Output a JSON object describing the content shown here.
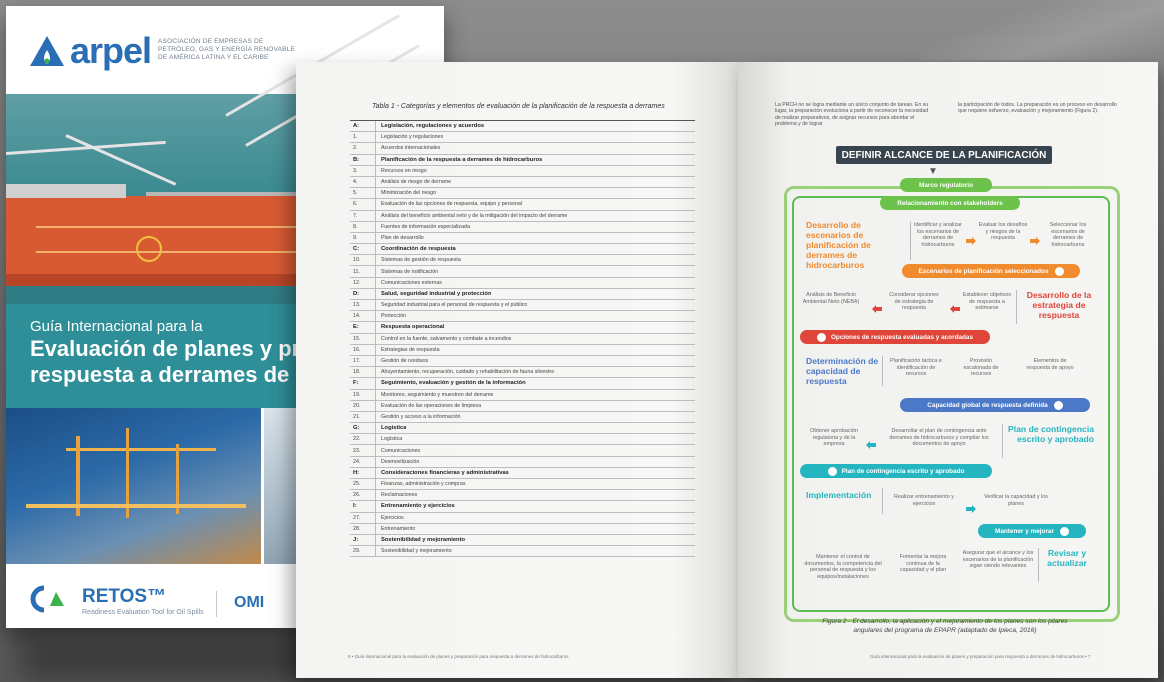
{
  "cover": {
    "logo_word": "arpel",
    "logo_desc": "ASOCIACIÓN DE EMPRESAS DE PETRÓLEO, GAS Y ENERGÍA RENOVABLE DE AMÉRICA LATINA Y EL CARIBE",
    "subtitle": "Guía Internacional para la",
    "title_line1": "Evaluación de planes y prep",
    "title_line2": "respuesta a derrames de hi",
    "retos_label": "RETOS™",
    "retos_sub": "Readiness Evaluation Tool for Oil Spills",
    "omi_label": "OMI"
  },
  "left_page": {
    "table_title": "Tabla 1 - Categorías y elementos de evaluación de la planificación de la respuesta a derrames",
    "rows": [
      {
        "id": "A:",
        "text": "Legislación, regulaciones y acuerdos",
        "section": true
      },
      {
        "id": "1.",
        "text": "Legislación y regulaciones",
        "section": false
      },
      {
        "id": "2.",
        "text": "Acuerdos internacionales",
        "section": false
      },
      {
        "id": "B:",
        "text": "Planificación de la respuesta a derrames de hidrocarburos",
        "section": true
      },
      {
        "id": "3.",
        "text": "Recursos en riesgo",
        "section": false
      },
      {
        "id": "4.",
        "text": "Análisis de riesgo de derrame",
        "section": false
      },
      {
        "id": "5.",
        "text": "Minimización del riesgo",
        "section": false
      },
      {
        "id": "6.",
        "text": "Evaluación de las opciones de respuesta, equipo y personal",
        "section": false
      },
      {
        "id": "7.",
        "text": "Análisis del beneficio ambiental neto y de la mitigación del impacto del derrame",
        "section": false
      },
      {
        "id": "8.",
        "text": "Fuentes de información especializada",
        "section": false
      },
      {
        "id": "9.",
        "text": "Plan de desarrollo",
        "section": false
      },
      {
        "id": "C:",
        "text": "Coordinación de respuesta",
        "section": true
      },
      {
        "id": "10.",
        "text": "Sistemas de gestión de respuesta",
        "section": false
      },
      {
        "id": "11.",
        "text": "Sistemas de notificación",
        "section": false
      },
      {
        "id": "12.",
        "text": "Comunicaciones externas",
        "section": false
      },
      {
        "id": "D:",
        "text": "Salud, seguridad industrial y protección",
        "section": true
      },
      {
        "id": "13.",
        "text": "Seguridad industrial para el personal de respuesta y el público",
        "section": false
      },
      {
        "id": "14.",
        "text": "Protección",
        "section": false
      },
      {
        "id": "E:",
        "text": "Respuesta operacional",
        "section": true
      },
      {
        "id": "15.",
        "text": "Control en la fuente, salvamento y combate a incendios",
        "section": false
      },
      {
        "id": "16.",
        "text": "Estrategias de respuesta",
        "section": false
      },
      {
        "id": "17.",
        "text": "Gestión de residuos",
        "section": false
      },
      {
        "id": "18.",
        "text": "Ahuyentamiento, recuperación, cuidado y rehabilitación de fauna silvestre",
        "section": false
      },
      {
        "id": "F:",
        "text": "Seguimiento, evaluación y gestión de la información",
        "section": true
      },
      {
        "id": "19.",
        "text": "Monitoreo, seguimiento y muestreo del derrame",
        "section": false
      },
      {
        "id": "20.",
        "text": "Evaluación de las operaciones de limpieza",
        "section": false
      },
      {
        "id": "21.",
        "text": "Gestión y acceso a la información",
        "section": false
      },
      {
        "id": "G:",
        "text": "Logística",
        "section": true
      },
      {
        "id": "22.",
        "text": "Logística",
        "section": false
      },
      {
        "id": "23.",
        "text": "Comunicaciones",
        "section": false
      },
      {
        "id": "24.",
        "text": "Desmovilización",
        "section": false
      },
      {
        "id": "H:",
        "text": "Consideraciones financieras y administrativas",
        "section": true
      },
      {
        "id": "25.",
        "text": "Finanzas, administración y compras",
        "section": false
      },
      {
        "id": "26.",
        "text": "Reclamaciones",
        "section": false
      },
      {
        "id": "I:",
        "text": "Entrenamiento y ejercicios",
        "section": true
      },
      {
        "id": "27.",
        "text": "Ejercicios",
        "section": false
      },
      {
        "id": "28.",
        "text": "Entrenamiento",
        "section": false
      },
      {
        "id": "J:",
        "text": "Sostenibilidad y mejoramiento",
        "section": true
      },
      {
        "id": "29.",
        "text": "Sostenibilidad y mejoramiento",
        "section": false
      }
    ],
    "footer": "8 • Guía internacional para la evaluación de planes y preparación para respuesta a derrames de hidrocarburos"
  },
  "right_page": {
    "para_left": "La PRCH no se logra mediante un único conjunto de tareas. En su lugar, la preparación evoluciona a partir de reconocer la necesidad de realizar preparativos, de asignar recursos para abordar el problema y de lograr",
    "para_right": "la participación de todos. La preparación es un proceso en desarrollo que requiere esfuerzo, evaluación y mejoramiento (Figura 2).",
    "diagram_title": "DEFINIR ALCANCE DE LA PLANIFICACIÓN",
    "pill_marco": "Marco regulatorio",
    "pill_relacion": "Relacionamiento con stakeholders",
    "big_escenarios": "Desarrollo de escenarios de planificación de derrames de hidrocarburos",
    "s_identificar": "Identificar y analizar los escenarios de derrames de hidrocarburos",
    "s_evaluar": "Evaluar los desafíos y riesgos de la respuesta",
    "s_seleccionar": "Seleccionar los escenarios de derrames de hidrocarburos",
    "pill_escenarios_sel": "Escenarios de planificación seleccionados",
    "s_analisis": "Análisis de Beneficio Ambiental Neto (NEBA)",
    "s_considerar": "Considerar opciones de estrategia de respuesta",
    "s_establecer": "Establecer objetivos de respuesta a estimarse",
    "big_estrategia": "Desarrollo de la estrategia de respuesta",
    "pill_opciones": "Opciones de respuesta evaluadas y acordadas",
    "big_capacidad": "Determinación de capacidad de respuesta",
    "s_planificacion": "Planificación táctica e identificación de recursos",
    "s_provision": "Provisión escalonada de recursos",
    "s_elementos": "Elementos de respuesta de apoyo",
    "pill_capacidad": "Capacidad global de respuesta definida",
    "s_obtener": "Obtener aprobación regulatoria y de la empresa",
    "s_desarrollar": "Desarrollar el plan de contingencia ante derrames de hidrocarburos y compilar los documentos de apoyo",
    "big_plan": "Plan de contingencia escrito y aprobado",
    "pill_plan": "Plan de contingencia escrito y aprobado",
    "big_implementacion": "Implementación",
    "s_realizar": "Realizar entrenamiento y ejercicios",
    "s_verificar": "Verificar la capacidad y los planes",
    "pill_mantener": "Mantener y mejorar",
    "s_mantener": "Mantener el control de documentos, la competencia del personal de respuesta y los equipos/instalaciones",
    "s_fomentar": "Fomentar la mejora continua de la capacidad y el plan",
    "s_asegurar": "Asegurar que el alcance y los escenarios de la planificación sigan siendo relevantes",
    "big_revisar": "Revisar y actualizar",
    "caption": "Figura 2 - El desarrollo, la aplicación y el mejoramiento de los planes son los pilares angulares del programa de EPAPR (adaptado de Ipieca, 2016)",
    "footer": "Guía internacional para la evaluación de planes y preparación para respuesta a derrames de hidrocarburos • 7"
  },
  "colors": {
    "brand_blue": "#2a6fb5",
    "teal": "#2e8f98",
    "orange": "#f08b2e",
    "red": "#e0453a",
    "blue": "#4b79c7",
    "green": "#5bbf4f",
    "cyan": "#25b5c0"
  }
}
